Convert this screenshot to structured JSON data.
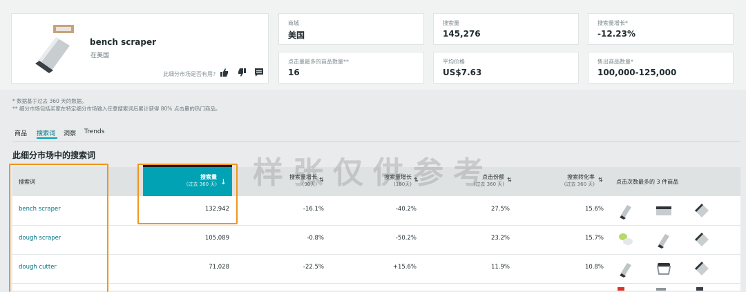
{
  "product": {
    "name": "bench scraper",
    "region": "在美国",
    "feedback_prompt": "此细分市场是否有用?"
  },
  "metrics": [
    {
      "label": "商城",
      "value": "美国"
    },
    {
      "label": "搜索量",
      "value": "145,276"
    },
    {
      "label": "搜索量增长*",
      "value": "-12.23%"
    },
    {
      "label": "点击量最多的商品数量**",
      "value": "16"
    },
    {
      "label": "平均价格",
      "value": "US$7.63"
    },
    {
      "label": "售出商品数量*",
      "value": "100,000-125,000"
    }
  ],
  "notes": [
    "* 数据基于过去 360 天的数据。",
    "** 细分市场包括买家在特定细分市场输入任意搜索词后累计获得 80% 点击量的热门商品。"
  ],
  "tabs": [
    "商品",
    "搜索词",
    "洞察",
    "Trends"
  ],
  "active_tab": "搜索词",
  "section_title": "此细分市场中的搜索词",
  "table": {
    "headers": {
      "term": "搜索词",
      "volume": "搜索量",
      "volume_sub": "(过去 360 天)",
      "growth_yoy": "搜索量增长",
      "growth_yoy_sub": "(90天)",
      "growth_180": "搜索量增长",
      "growth_180_sub": "(180天)",
      "click_share": "点击份额",
      "click_share_sub": "(过去 360 天)",
      "conversion": "搜索转化率",
      "conversion_sub": "(过去 360 天)",
      "top_products": "点击次数最多的 3 件商品"
    },
    "rows": [
      {
        "term": "bench scraper",
        "volume": "132,942",
        "growth_90": "-16.1%",
        "growth_180": "-40.2%",
        "click_share": "27.5%",
        "conversion": "15.6%"
      },
      {
        "term": "dough scraper",
        "volume": "105,089",
        "growth_90": "-0.8%",
        "growth_180": "-50.2%",
        "click_share": "23.2%",
        "conversion": "15.7%"
      },
      {
        "term": "dough cutter",
        "volume": "71,028",
        "growth_90": "-22.5%",
        "growth_180": "+15.6%",
        "click_share": "11.9%",
        "conversion": "10.8%"
      }
    ]
  },
  "watermark": "样张仅供参考",
  "colors": {
    "accent": "#00a2b3",
    "highlight": "#f0961c",
    "link": "#007185"
  }
}
